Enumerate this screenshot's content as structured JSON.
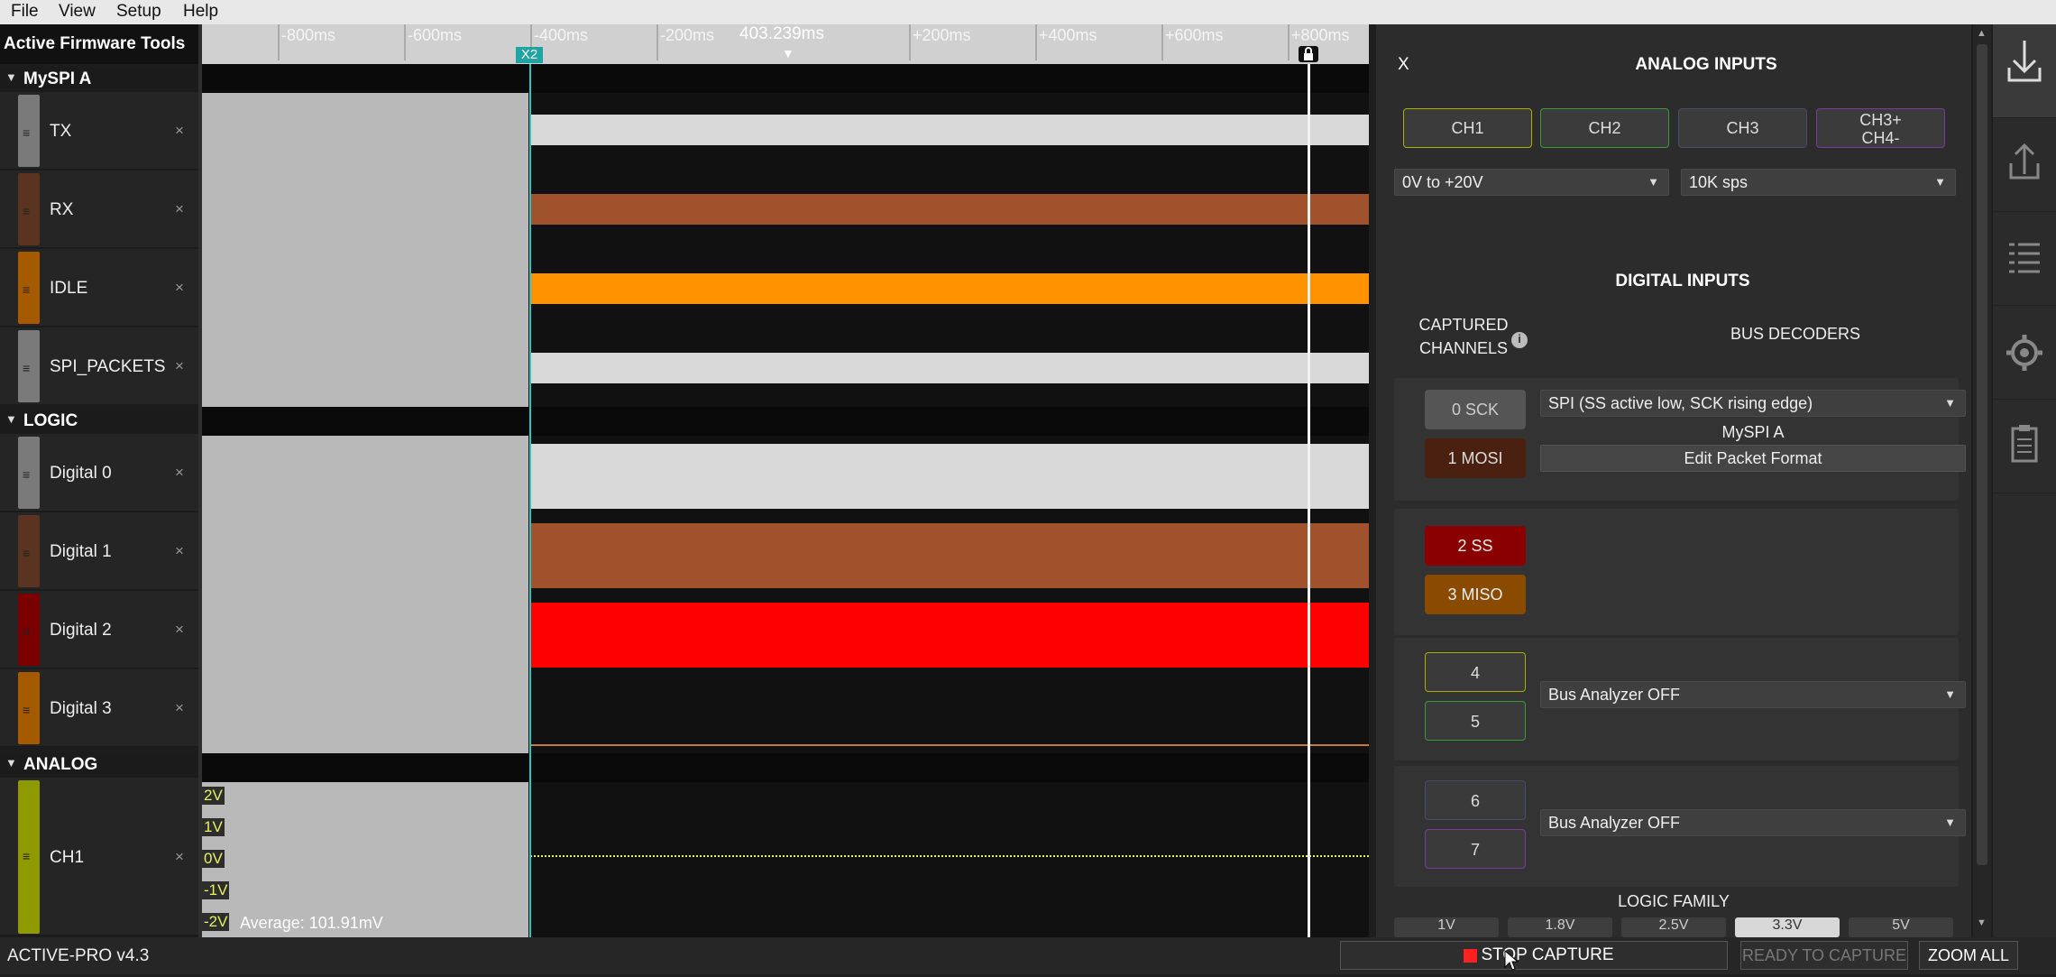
{
  "menu": {
    "file": "File",
    "view": "View",
    "setup": "Setup",
    "help": "Help"
  },
  "sidebar_title": "Active Firmware Tools",
  "groups": {
    "myspi": {
      "label": "MySPI A",
      "channels": [
        {
          "label": "TX",
          "color": "#7a7a7a"
        },
        {
          "label": "RX",
          "color": "#5a3420"
        },
        {
          "label": "IDLE",
          "color": "#a65a00"
        },
        {
          "label": "SPI_PACKETS",
          "color": "#7a7a7a"
        }
      ]
    },
    "logic": {
      "label": "LOGIC",
      "channels": [
        {
          "label": "Digital 0",
          "color": "#7a7a7a"
        },
        {
          "label": "Digital 1",
          "color": "#5a3420"
        },
        {
          "label": "Digital 2",
          "color": "#7a0000"
        },
        {
          "label": "Digital 3",
          "color": "#a65a00"
        }
      ]
    },
    "analog": {
      "label": "ANALOG",
      "channels": [
        {
          "label": "CH1",
          "color": "#8e9a00"
        }
      ]
    }
  },
  "close_glyph": "×",
  "ruler": {
    "ticks": [
      "-800ms",
      "-600ms",
      "-400ms",
      "-200ms",
      "+200ms",
      "+400ms",
      "+600ms",
      "+800ms"
    ],
    "center_time": "403.239ms",
    "cursor_label": "X2"
  },
  "trace_colors": {
    "gray": "#d9d9d9",
    "brown": "#a0522d",
    "orange": "#ff9200",
    "red": "#ff0000"
  },
  "analog_scale": [
    "2V",
    "1V",
    "0V",
    "-1V",
    "-2V"
  ],
  "analog_average": "Average: 101.91mV",
  "panel": {
    "close": "X",
    "analog_title": "ANALOG INPUTS",
    "analog_channels": [
      {
        "label": "CH1",
        "color": "#a8b000"
      },
      {
        "label": "CH2",
        "color": "#3a9a3a"
      },
      {
        "label": "CH3",
        "color": "#4a4a6a"
      },
      {
        "label": "CH3+\nCH4-",
        "color": "#7a3aa0"
      }
    ],
    "range_select": "0V to +20V",
    "rate_select": "10K sps",
    "digital_title": "DIGITAL INPUTS",
    "captured_channels": "CAPTURED\nCHANNELS",
    "bus_decoders": "BUS DECODERS",
    "bus1": {
      "sck": "0 SCK",
      "mosi": "1 MOSI",
      "decoder": "SPI (SS active low, SCK rising edge)",
      "name": "MySPI A",
      "edit": "Edit Packet Format"
    },
    "bus2": {
      "ss": "2 SS",
      "miso": "3 MISO"
    },
    "bus3": {
      "a": "4",
      "b": "5",
      "decoder": "Bus Analyzer OFF"
    },
    "bus4": {
      "a": "6",
      "b": "7",
      "decoder": "Bus Analyzer OFF"
    },
    "logic_family_title": "LOGIC FAMILY",
    "logic_family": [
      "1V",
      "1.8V",
      "2.5V",
      "3.3V",
      "5V"
    ]
  },
  "status": {
    "version": "ACTIVE-PRO v4.3",
    "stop_capture": "STOP CAPTURE",
    "ready": "READY TO CAPTURE",
    "zoom_all": "ZOOM ALL"
  }
}
